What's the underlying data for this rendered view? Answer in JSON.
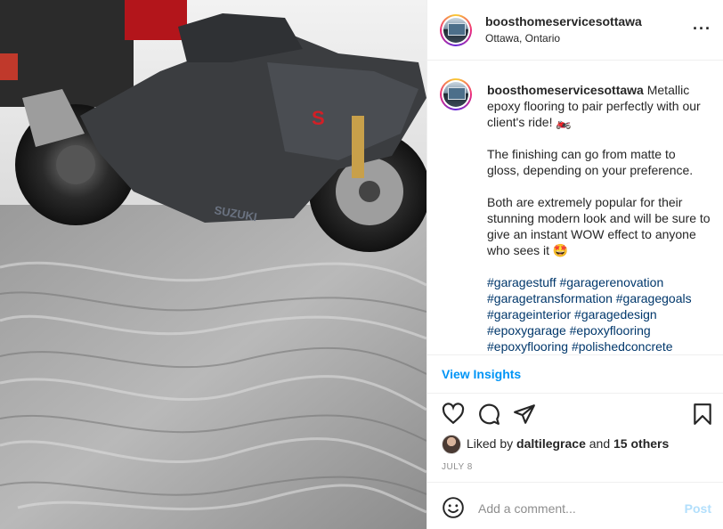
{
  "post": {
    "username": "boosthomeservicesottawa",
    "location": "Ottawa, Ontario",
    "more_icon": "more-horizontal-icon",
    "caption": {
      "line1": "Metallic epoxy flooring to pair perfectly with our client's ride! 🏍️",
      "para2": "The finishing can go from matte to gloss, depending on your preference.",
      "para3": "Both are extremely popular for their stunning modern look and will be sure to give an instant WOW effect to anyone who sees it 🤩",
      "hashtags": "#garagestuff #garagerenovation #garagetransformation #garagegoals #garageinterior #garagedesign #epoxygarage #epoxyflooring #epoxyflooring #polishedconcrete"
    },
    "view_insights": "View Insights",
    "likes": {
      "prefix": "Liked by",
      "user": "daltilegrace",
      "and": "and",
      "others": "15 others"
    },
    "date": "JULY 8",
    "comment": {
      "placeholder": "Add a comment...",
      "post_label": "Post"
    },
    "colors": {
      "link": "#0095f6",
      "hashtag": "#00376b",
      "muted": "#8e8e8e",
      "post_disabled": "#b2dffc"
    },
    "icons": [
      "heart-icon",
      "comment-icon",
      "share-icon",
      "bookmark-icon",
      "emoji-icon"
    ]
  }
}
